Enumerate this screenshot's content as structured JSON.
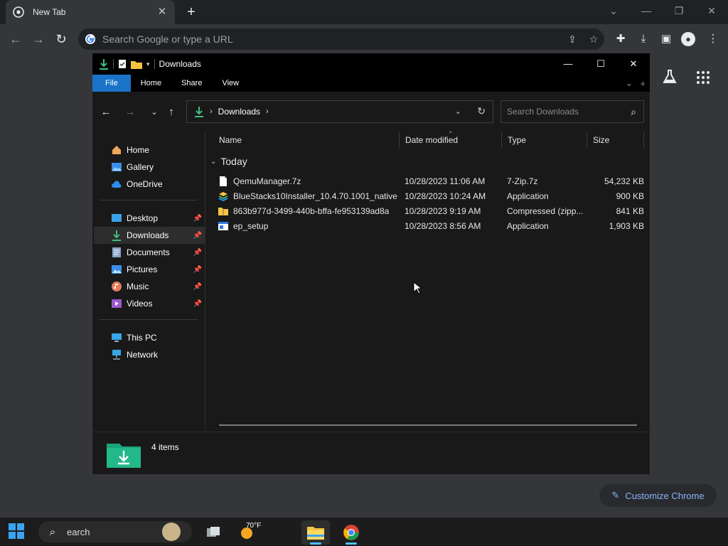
{
  "browser": {
    "tab_title": "New Tab",
    "omnibox_placeholder": "Search Google or type a URL",
    "customize_label": "Customize Chrome"
  },
  "explorer": {
    "title": "Downloads",
    "ribbon_tabs": [
      "File",
      "Home",
      "Share",
      "View"
    ],
    "breadcrumb": "Downloads",
    "search_placeholder": "Search Downloads",
    "nav": {
      "quick": [
        {
          "label": "Home",
          "icon": "home-icon"
        },
        {
          "label": "Gallery",
          "icon": "gallery-icon"
        },
        {
          "label": "OneDrive",
          "icon": "cloud-icon"
        }
      ],
      "pinned": [
        {
          "label": "Desktop",
          "icon": "desktop-icon"
        },
        {
          "label": "Downloads",
          "icon": "download-icon",
          "selected": true
        },
        {
          "label": "Documents",
          "icon": "documents-icon"
        },
        {
          "label": "Pictures",
          "icon": "pictures-icon"
        },
        {
          "label": "Music",
          "icon": "music-icon"
        },
        {
          "label": "Videos",
          "icon": "videos-icon"
        }
      ],
      "devices": [
        {
          "label": "This PC",
          "icon": "monitor-icon"
        },
        {
          "label": "Network",
          "icon": "network-icon"
        }
      ]
    },
    "columns": [
      "Name",
      "Date modified",
      "Type",
      "Size"
    ],
    "group_label": "Today",
    "files": [
      {
        "name": "QemuManager.7z",
        "date": "10/28/2023 11:06 AM",
        "type": "7-Zip.7z",
        "size": "54,232 KB",
        "icon": "file-icon"
      },
      {
        "name": "BlueStacks10Installer_10.4.70.1001_native...",
        "date": "10/28/2023 10:24 AM",
        "type": "Application",
        "size": "900 KB",
        "icon": "bluestacks-icon"
      },
      {
        "name": "863b977d-3499-440b-bffa-fe953139ad8a",
        "date": "10/28/2023 9:19 AM",
        "type": "Compressed (zipp...",
        "size": "841 KB",
        "icon": "zip-folder-icon"
      },
      {
        "name": "ep_setup",
        "date": "10/28/2023 8:56 AM",
        "type": "Application",
        "size": "1,903 KB",
        "icon": "app-icon"
      }
    ],
    "status_count": "4 items"
  },
  "taskbar": {
    "search_text": "earch",
    "weather_temp": "70°F"
  }
}
